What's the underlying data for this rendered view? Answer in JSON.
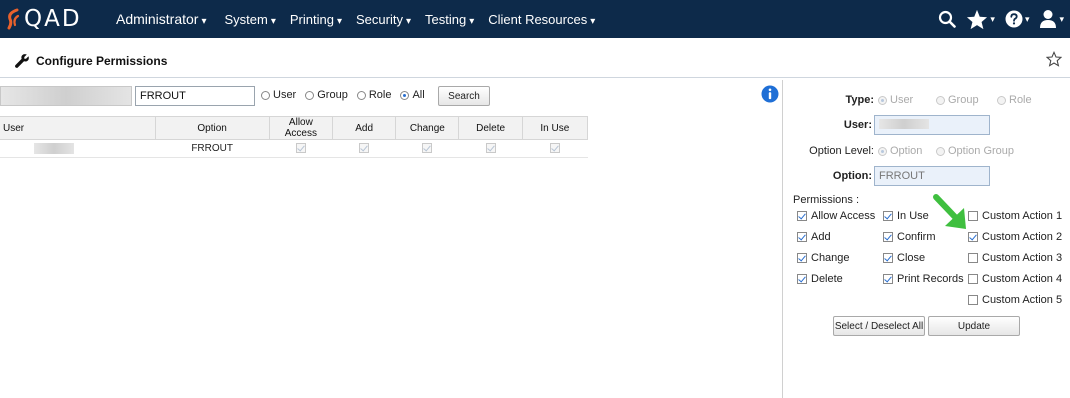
{
  "brand": {
    "logo_text": "QAD",
    "accent": "#e8612c",
    "bar_color": "#0d2a4a"
  },
  "nav": {
    "items": [
      {
        "label": "Administrator"
      },
      {
        "label": "System"
      },
      {
        "label": "Printing"
      },
      {
        "label": "Security"
      },
      {
        "label": "Testing"
      },
      {
        "label": "Client Resources"
      }
    ],
    "caret": "▾",
    "icons": [
      "search-icon",
      "star-icon",
      "help-icon",
      "user-icon"
    ]
  },
  "page": {
    "title": "Configure Permissions",
    "title_icon": "wrench-icon"
  },
  "search": {
    "option_value": "FRROUT",
    "filters": [
      {
        "label": "User",
        "selected": false
      },
      {
        "label": "Group",
        "selected": false
      },
      {
        "label": "Role",
        "selected": false
      },
      {
        "label": "All",
        "selected": true
      }
    ],
    "search_button": "Search"
  },
  "table": {
    "columns": [
      "User",
      "Option",
      "Allow Access",
      "Add",
      "Change",
      "Delete",
      "In Use"
    ],
    "rows": [
      {
        "option": "FRROUT",
        "allow": true,
        "add": true,
        "change": true,
        "delete": true,
        "inuse": true
      }
    ]
  },
  "detail": {
    "type_label": "Type:",
    "type_options": [
      "User",
      "Group",
      "Role"
    ],
    "user_label": "User:",
    "option_level_label": "Option Level:",
    "option_level_options": [
      "Option",
      "Option Group"
    ],
    "option_label": "Option:",
    "option_value": "FRROUT",
    "permissions_label": "Permissions :",
    "permissions": [
      {
        "label": "Allow Access",
        "checked": true
      },
      {
        "label": "Add",
        "checked": true
      },
      {
        "label": "Change",
        "checked": true
      },
      {
        "label": "Delete",
        "checked": true
      },
      {
        "label": "In Use",
        "checked": true
      },
      {
        "label": "Confirm",
        "checked": true
      },
      {
        "label": "Close",
        "checked": true
      },
      {
        "label": "Print Records",
        "checked": true
      },
      {
        "label": "Custom Action 1",
        "checked": false
      },
      {
        "label": "Custom Action 2",
        "checked": true
      },
      {
        "label": "Custom Action 3",
        "checked": false
      },
      {
        "label": "Custom Action 4",
        "checked": false
      },
      {
        "label": "Custom Action 5",
        "checked": false
      }
    ],
    "select_button": "Select / Deselect All",
    "update_button": "Update"
  },
  "annotation": {
    "arrow_color": "#3fbf3f"
  }
}
